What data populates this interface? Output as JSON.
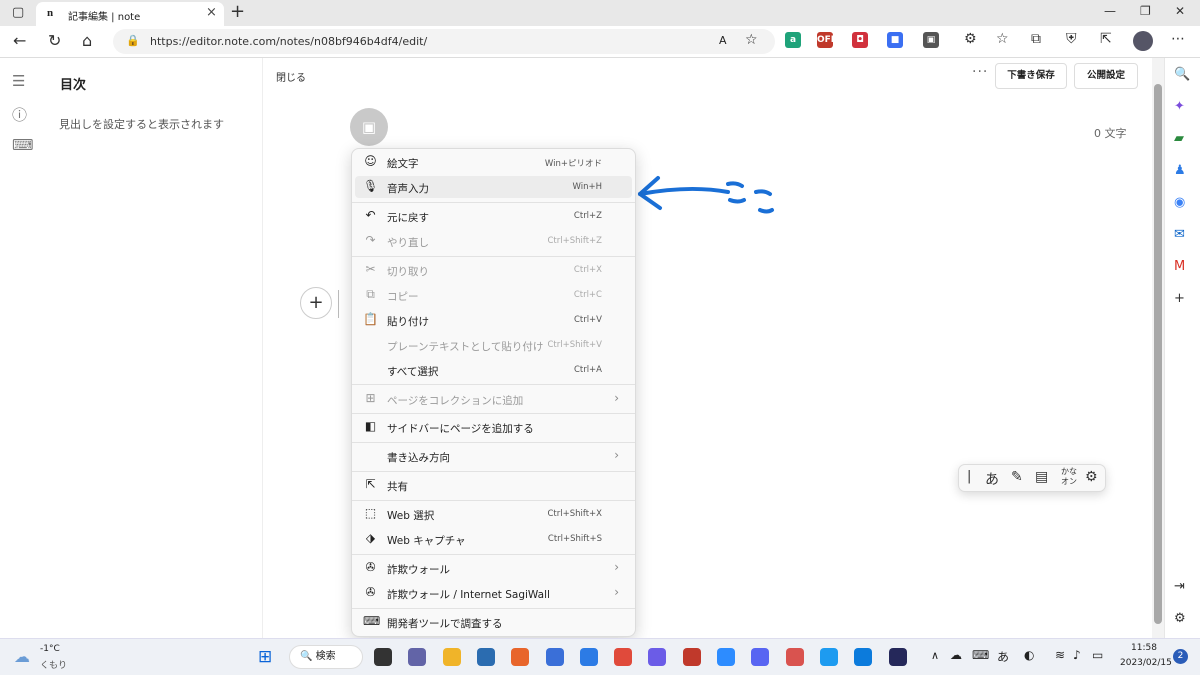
{
  "browser": {
    "tab_title": "記事編集 | note",
    "tab_favicon": "n",
    "url": "https://editor.note.com/notes/n08bf946b4df4/edit/",
    "read_aloud": "A",
    "extensions": [
      {
        "name": "a-ext-icon",
        "label": "a",
        "color": "#1fa37a"
      },
      {
        "name": "off-ext-icon",
        "label": "OFF",
        "color": "#c0392b"
      },
      {
        "name": "shield-ext-icon",
        "label": "◘",
        "color": "#d1313d"
      },
      {
        "name": "chat-ext-icon",
        "label": "■",
        "color": "#3b6ff2"
      },
      {
        "name": "box-ext-icon",
        "label": "▣",
        "color": "#555555"
      }
    ]
  },
  "sidebar": {
    "heading": "目次",
    "placeholder": "見出しを設定すると表示されます"
  },
  "editor": {
    "close_label": "閉じる",
    "more_label": "···",
    "save_draft_label": "下書き保存",
    "publish_label": "公開設定",
    "char_count": "0 文字",
    "add_label": "+"
  },
  "annotation": {
    "text": "ここ",
    "color": "#1a6fd6"
  },
  "context_menu": {
    "items": [
      {
        "icon": "☺",
        "icon_name": "emoji-icon",
        "label": "絵文字",
        "shortcut": "Win+ピリオド"
      },
      {
        "icon": "🎙",
        "icon_name": "microphone-icon",
        "label": "音声入力",
        "shortcut": "Win+H"
      },
      {
        "icon": "↶",
        "icon_name": "undo-icon",
        "label": "元に戻す",
        "shortcut": "Ctrl+Z"
      },
      {
        "icon": "↷",
        "icon_name": "redo-icon",
        "label": "やり直し",
        "shortcut": "Ctrl+Shift+Z"
      },
      {
        "icon": "✂",
        "icon_name": "cut-icon",
        "label": "切り取り",
        "shortcut": "Ctrl+X"
      },
      {
        "icon": "⧉",
        "icon_name": "copy-icon",
        "label": "コピー",
        "shortcut": "Ctrl+C"
      },
      {
        "icon": "📋",
        "icon_name": "paste-icon",
        "label": "貼り付け",
        "shortcut": "Ctrl+V"
      },
      {
        "icon": "",
        "icon_name": "blank-icon",
        "label": "プレーンテキストとして貼り付け",
        "shortcut": "Ctrl+Shift+V"
      },
      {
        "icon": "",
        "icon_name": "blank-icon",
        "label": "すべて選択",
        "shortcut": "Ctrl+A"
      },
      {
        "icon": "⊞",
        "icon_name": "collection-icon",
        "label": "ページをコレクションに追加",
        "shortcut": ""
      },
      {
        "icon": "◧",
        "icon_name": "sidebar-add-icon",
        "label": "サイドバーにページを追加する",
        "shortcut": ""
      },
      {
        "icon": "",
        "icon_name": "blank-icon",
        "label": "書き込み方向",
        "shortcut": ""
      },
      {
        "icon": "⇱",
        "icon_name": "share-icon",
        "label": "共有",
        "shortcut": ""
      },
      {
        "icon": "⬚",
        "icon_name": "web-select-icon",
        "label": "Web 選択",
        "shortcut": "Ctrl+Shift+X"
      },
      {
        "icon": "⬗",
        "icon_name": "web-capture-icon",
        "label": "Web キャプチャ",
        "shortcut": "Ctrl+Shift+S"
      },
      {
        "icon": "✇",
        "icon_name": "sagiwall-icon",
        "label": "詐欺ウォール",
        "shortcut": ""
      },
      {
        "icon": "✇",
        "icon_name": "sagiwall-icon",
        "label": "詐欺ウォール / Internet SagiWall",
        "shortcut": ""
      },
      {
        "icon": "⌨",
        "icon_name": "devtools-icon",
        "label": "開発者ツールで調査する",
        "shortcut": ""
      }
    ],
    "arrow": "›"
  },
  "ime_toolbar": {
    "kana_top": "かな",
    "kana_bottom": "オン",
    "hiragana": "あ"
  },
  "taskbar": {
    "weather_temp": "-1°C",
    "weather_desc": "くもり",
    "search_label": "検索",
    "ime_label": "あ",
    "time": "11:58",
    "date": "2023/02/15",
    "notification_count": "2"
  }
}
